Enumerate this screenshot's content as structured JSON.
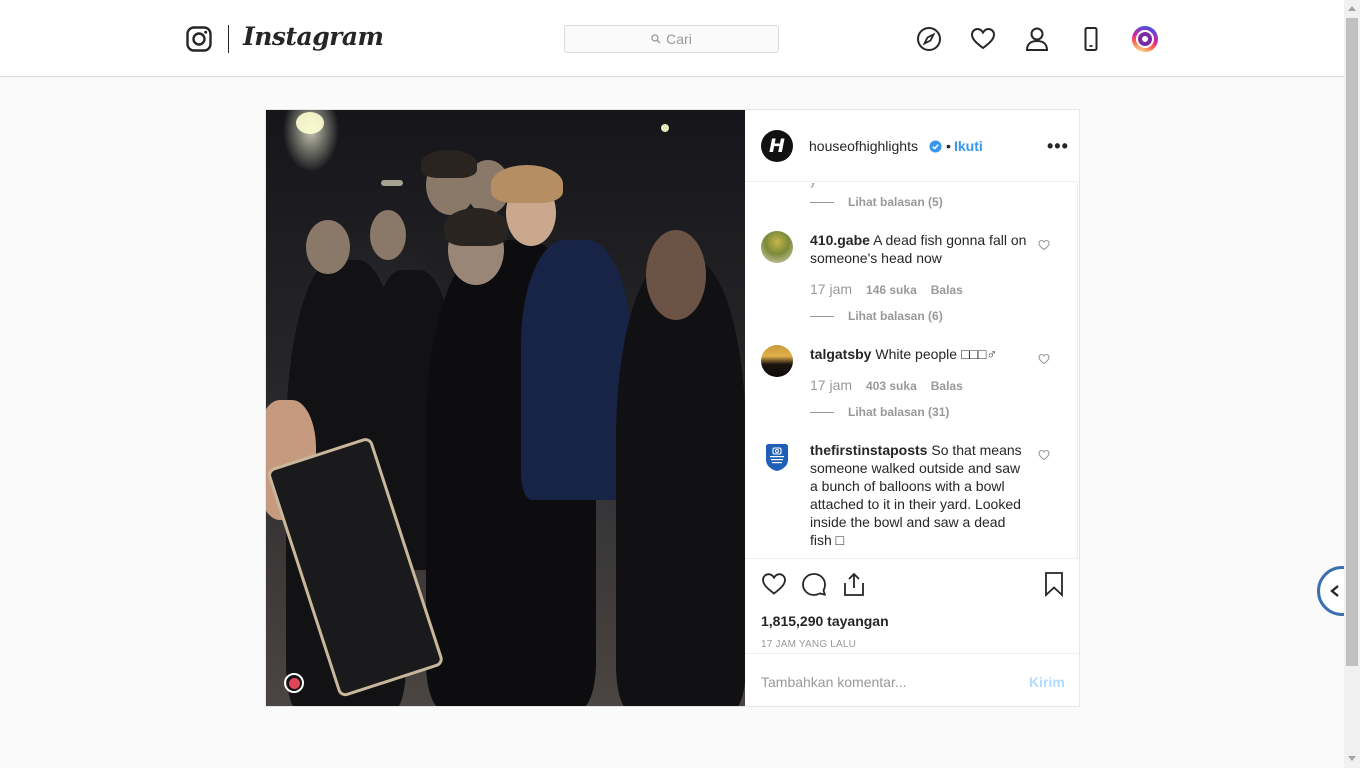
{
  "header": {
    "wordmark": "Instagram",
    "search_placeholder": "Cari",
    "icons": [
      "instagram-glyph-icon",
      "compass-icon",
      "heart-icon",
      "user-icon",
      "mobile-icon",
      "profile-avatar-icon"
    ]
  },
  "post": {
    "username": "houseofhighlights",
    "avatar_letter": "H",
    "verified": true,
    "separator": "•",
    "follow_label": "Ikuti",
    "more_label": "•••",
    "comments": [
      {
        "reply_label": "Lihat balasan (5)"
      },
      {
        "username": "410.gabe",
        "text": "A dead fish gonna fall on someone's head now",
        "time": "17 jam",
        "likes": "146 suka",
        "reply_action": "Balas",
        "replies_label": "Lihat balasan (6)"
      },
      {
        "username": "talgatsby",
        "text": "White people □□□♂",
        "time": "17 jam",
        "likes": "403 suka",
        "reply_action": "Balas",
        "replies_label": "Lihat balasan (31)"
      },
      {
        "username": "thefirstinstaposts",
        "text": "So that means someone walked outside and saw a bunch of balloons with a bowl attached to it in their yard. Looked inside the bowl and saw a dead fish □",
        "avatar_text": "THE 1ST INSTA POSTS"
      }
    ],
    "views": "1,815,290 tayangan",
    "time_ago": "17 JAM YANG LALU",
    "comment_placeholder": "Tambahkan komentar...",
    "send_label": "Kirim"
  },
  "colors": {
    "accent": "#3897f0",
    "send_disabled": "#b3dbff",
    "muted": "#999999",
    "text": "#262626"
  }
}
